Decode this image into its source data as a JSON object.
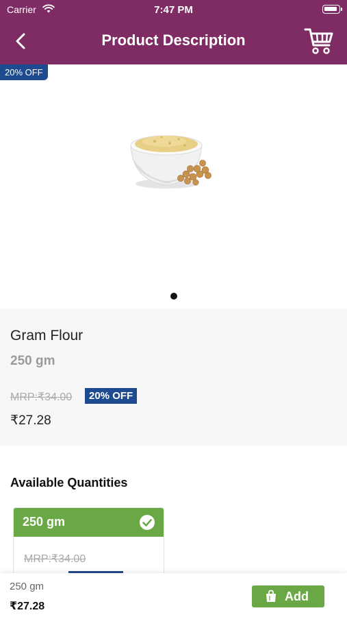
{
  "status_bar": {
    "carrier": "Carrier",
    "time": "7:47 PM"
  },
  "header": {
    "title": "Product Description",
    "background": "#7f2c64"
  },
  "image_area": {
    "discount_badge": "20% OFF",
    "page_indicator": {
      "count": 1,
      "active": 0
    }
  },
  "product": {
    "name": "Gram Flour",
    "weight": "250 gm",
    "mrp": "MRP:₹34.00",
    "discount": "20% OFF",
    "price": "₹27.28"
  },
  "quantities": {
    "title": "Available Quantities",
    "options": [
      {
        "label": "250 gm",
        "mrp": "MRP:₹34.00",
        "selected": true
      }
    ]
  },
  "bottom_bar": {
    "weight": "250 gm",
    "price": "₹27.28",
    "add_label": "Add"
  },
  "colors": {
    "brand": "#7f2c64",
    "accent_blue": "#1e4b8f",
    "accent_green": "#6aa845"
  },
  "icons": [
    "wifi-icon",
    "battery-icon",
    "back-chevron-icon",
    "cart-icon",
    "check-circle-icon",
    "shopping-bag-icon"
  ]
}
